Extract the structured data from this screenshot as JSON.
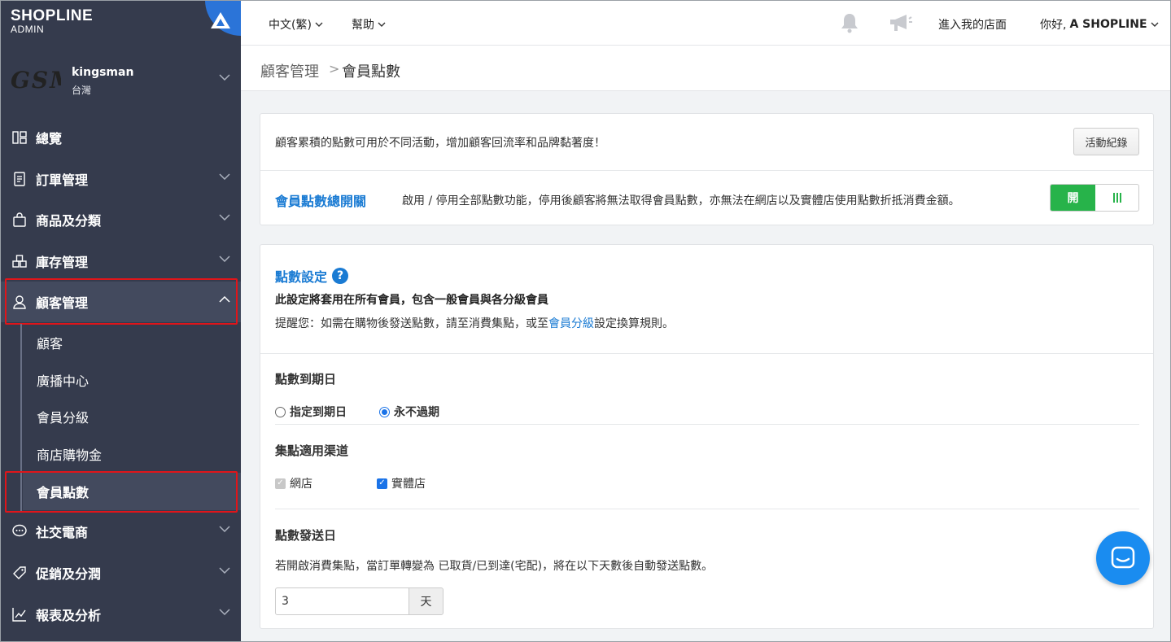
{
  "app": {
    "brand": "SHOPLINE",
    "brand_sub": "ADMIN"
  },
  "store": {
    "logo_text": "GSM",
    "name": "kingsman",
    "region": "台灣"
  },
  "sidebar": {
    "items": [
      {
        "label": "總覽"
      },
      {
        "label": "訂單管理"
      },
      {
        "label": "商品及分類"
      },
      {
        "label": "庫存管理"
      },
      {
        "label": "顧客管理"
      },
      {
        "label": "社交電商"
      },
      {
        "label": "促銷及分潤"
      },
      {
        "label": "報表及分析"
      }
    ],
    "sub_items": [
      {
        "label": "顧客"
      },
      {
        "label": "廣播中心"
      },
      {
        "label": "會員分級"
      },
      {
        "label": "商店購物金"
      },
      {
        "label": "會員點數"
      }
    ]
  },
  "topbar": {
    "language": "中文(繁)",
    "help": "幫助",
    "enter_store": "進入我的店面",
    "greeting": "你好,",
    "user": "A SHOPLINE"
  },
  "breadcrumb": {
    "parent": "顧客管理",
    "separator": ">",
    "current": "會員點數"
  },
  "intro": {
    "text": "顧客累積的點數可用於不同活動，增加顧客回流率和品牌黏著度！",
    "log_button": "活動紀錄",
    "toggle_label": "會員點數總開關",
    "toggle_desc": "啟用 / 停用全部點數功能，停用後顧客將無法取得會員點數，亦無法在網店以及實體店使用點數折抵消費金額。",
    "toggle_state": "開"
  },
  "settings": {
    "title": "點數設定",
    "help_glyph": "?",
    "applies": "此設定將套用在所有會員，包含一般會員與各分級會員",
    "remind_prefix": "提醒您：如需在購物後發送點數，請至消費集點，或至",
    "remind_link": "會員分級",
    "remind_suffix": "設定換算規則。",
    "expiry": {
      "title": "點數到期日",
      "options": [
        {
          "label": "指定到期日",
          "selected": false
        },
        {
          "label": "永不過期",
          "selected": true
        }
      ]
    },
    "channels": {
      "title": "集點適用渠道",
      "options": [
        {
          "label": "網店",
          "checked": true,
          "disabled": true
        },
        {
          "label": "實體店",
          "checked": true,
          "disabled": false
        }
      ]
    },
    "send_day": {
      "title": "點數發送日",
      "desc": "若開啟消費集點，當訂單轉變為 已取貨/已到達(宅配)，將在以下天數後自動發送點數。",
      "value": "3",
      "unit": "天"
    }
  },
  "colors": {
    "sidebar_bg": "#353b4d",
    "accent_blue": "#1a7bd3",
    "switch_green": "#27b34a",
    "highlight_red": "#e0151a"
  }
}
